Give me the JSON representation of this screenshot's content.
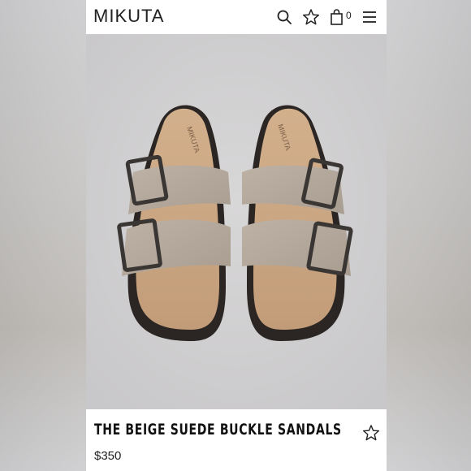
{
  "brand": {
    "logo_text": "MIKUTA"
  },
  "header": {
    "icons": [
      "search-icon",
      "star-icon",
      "shopping-bag-icon",
      "menu-icon"
    ],
    "cart_count": "0"
  },
  "product": {
    "name": "THE BEIGE SUEDE BUCKLE SANDALS",
    "price": "$350",
    "image_alt": "Beige suede sandals with two buckle straps",
    "insole_brand": "MIKUTA"
  },
  "colors": {
    "background": "#d2d1d2",
    "suede": "#b5aa9c",
    "footbed": "#c9a27e",
    "sole": "#2b2623",
    "text": "#111111"
  }
}
